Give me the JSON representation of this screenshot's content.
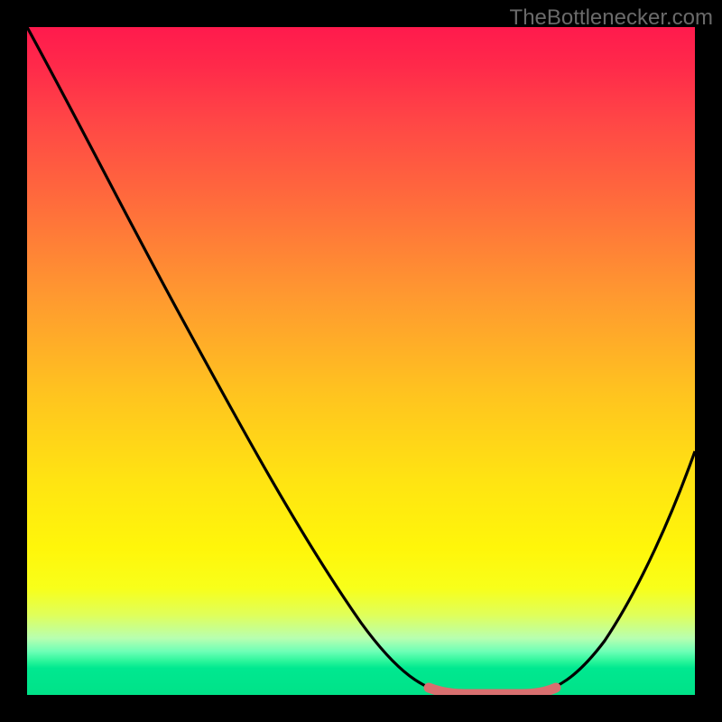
{
  "watermark": "TheBottlenecker.com",
  "chart_data": {
    "type": "line",
    "title": "",
    "xlabel": "",
    "ylabel": "",
    "xlim": [
      0,
      100
    ],
    "ylim": [
      0,
      100
    ],
    "series": [
      {
        "name": "bottleneck-curve",
        "x": [
          0,
          5,
          10,
          15,
          20,
          25,
          30,
          35,
          40,
          45,
          50,
          55,
          60,
          63,
          66,
          70,
          74,
          78,
          82,
          86,
          90,
          95,
          100
        ],
        "y": [
          100,
          92,
          84,
          76,
          68,
          60,
          52,
          44,
          36,
          28,
          20,
          12,
          5,
          1,
          0,
          0,
          0,
          1,
          5,
          12,
          20,
          30,
          40
        ]
      }
    ],
    "highlight": {
      "name": "optimal-range",
      "x": [
        62,
        78
      ],
      "color": "#d86f6f"
    },
    "gradient_stops": [
      {
        "pos": 0,
        "color": "#ff1a4d"
      },
      {
        "pos": 0.55,
        "color": "#ffc41f"
      },
      {
        "pos": 0.85,
        "color": "#f8ff1a"
      },
      {
        "pos": 1.0,
        "color": "#00e288"
      }
    ]
  }
}
